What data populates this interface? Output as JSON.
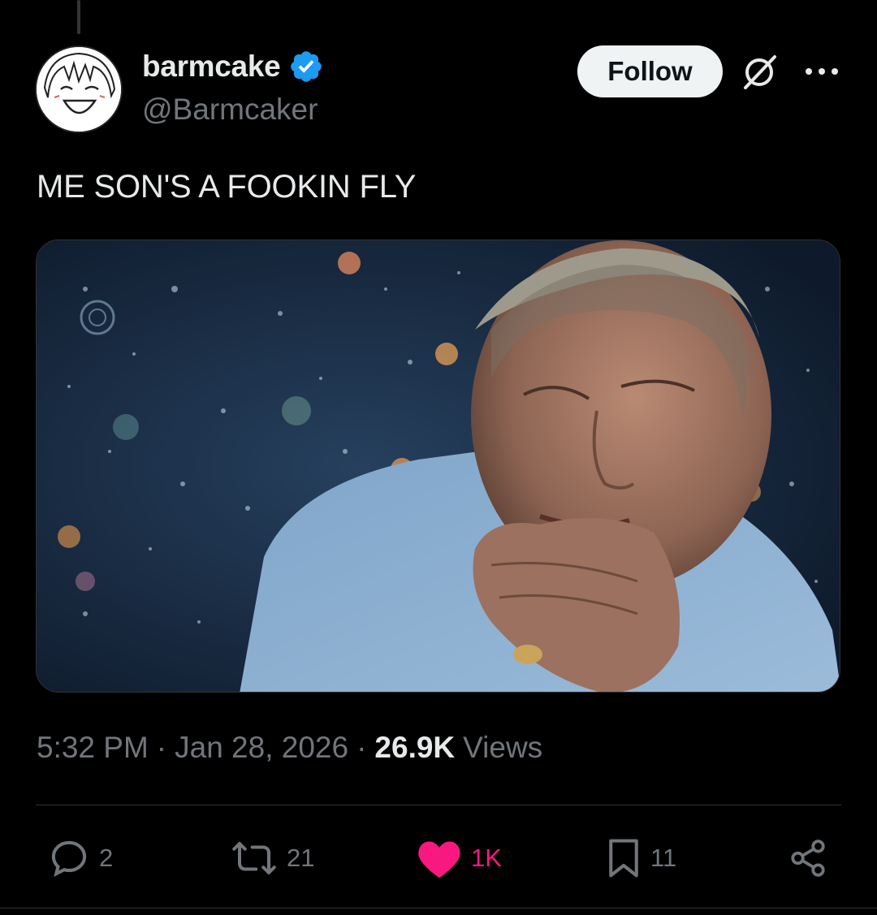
{
  "author": {
    "display_name": "barmcake",
    "handle": "@Barmcaker",
    "verified": true,
    "verified_color": "#1d9bf0"
  },
  "header": {
    "follow_label": "Follow",
    "grok_icon": "grok-icon",
    "more_icon": "more-icon"
  },
  "tweet": {
    "text": "ME SON'S A FOOKIN FLY"
  },
  "meta": {
    "time": "5:32 PM",
    "sep1": "·",
    "date": "Jan 28, 2026",
    "sep2": "·",
    "views_count": "26.9K",
    "views_label": "Views"
  },
  "actions": {
    "replies": "2",
    "reposts": "21",
    "likes": "1K",
    "bookmarks": "11"
  },
  "colors": {
    "like_active": "#f91880",
    "text_secondary": "#71767b",
    "background": "#000000"
  }
}
